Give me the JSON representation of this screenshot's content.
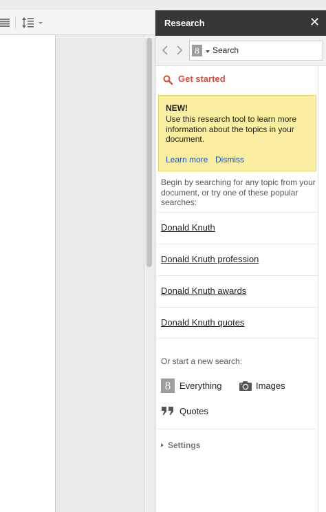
{
  "panel": {
    "title": "Research",
    "close_glyph": "✕"
  },
  "search": {
    "placeholder": "Search",
    "engine_badge": "8"
  },
  "get_started": {
    "label": "Get started",
    "accent": "#dd4b39"
  },
  "notice": {
    "title": "NEW!",
    "body": "Use this research tool to learn more information about the topics in your document.",
    "learn_more": "Learn more",
    "dismiss": "Dismiss"
  },
  "intro_text": "Begin by searching for any topic from your document, or try one of these popular searches:",
  "suggestions": [
    "Donald Knuth",
    "Donald Knuth profession",
    "Donald Knuth awards",
    "Donald Knuth quotes"
  ],
  "start_new": {
    "label": "Or start a new search:",
    "types": {
      "everything": "Everything",
      "images": "Images",
      "quotes": "Quotes"
    }
  },
  "settings_label": "Settings",
  "icons": {
    "toolbar": [
      "align-icon",
      "line-spacing-icon"
    ],
    "panel": [
      "close-icon",
      "back-icon",
      "forward-icon",
      "google-g-icon",
      "search-icon",
      "camera-icon",
      "quote-icon"
    ]
  },
  "colors": {
    "header_bg": "#373737",
    "link": "#1155cc",
    "notice_bg": "#f9eda0"
  }
}
